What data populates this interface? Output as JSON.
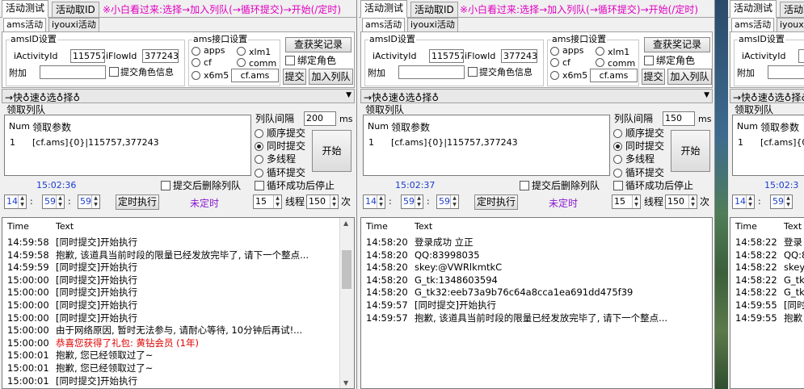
{
  "tabs": {
    "test": "活动测试",
    "fetch": "活动取ID"
  },
  "notice": "※小白看过来:选择→加入列队(→循环提交)→开始(/定时)",
  "subtabs": {
    "ams": "ams活动",
    "iyouxi": "iyouxi活动"
  },
  "amsid_group": {
    "title": "amsID设置",
    "iactivityid_label": "iActivityId",
    "iactivityid_value": "115757",
    "iflowid_label": "iFlowId",
    "iflowid_value": "377243",
    "extra_label": "附加",
    "extra_value": "",
    "submit_role_info": "提交角色信息"
  },
  "api_group": {
    "title": "ams接口设置",
    "options": [
      "apps",
      "xlm1",
      "cf",
      "comm",
      "x6m5"
    ],
    "selected": "",
    "api_value": "cf.ams",
    "submit_button": "提交"
  },
  "buttons": {
    "query_records": "查获奖记录",
    "bind_role": "绑定角色",
    "add_queue": "加入列队",
    "start": "开始",
    "timed_run": "定时执行"
  },
  "quickbar": "→快♁速♁选♁择♁",
  "queue": {
    "title": "领取列队",
    "col_num": "Num",
    "col_param": "领取参数",
    "row_num": "1",
    "row_param": "[cf.ams]{0}|115757,377243"
  },
  "queue_interval": {
    "label": "列队间隔",
    "unit": "ms"
  },
  "submit_modes": [
    "顺序提交",
    "同时提交",
    "多线程",
    "循环提交"
  ],
  "selected_mode": "同时提交",
  "options": {
    "delete_after_submit": "提交后删除列队",
    "stop_after_loop": "循环成功后停止",
    "untimed": "未定时",
    "thread_label": "线程",
    "times_label": "次"
  },
  "log_headers": {
    "time": "Time",
    "text": "Text"
  },
  "windows": [
    {
      "interval_value": "200",
      "clock": "15:02:36",
      "timer": {
        "h": "14",
        "m": "59",
        "s": "59"
      },
      "loop_count": "15",
      "thread_count": "150",
      "log": [
        {
          "time": "14:59:58",
          "text": "[同时提交]开始执行",
          "color": "#000000"
        },
        {
          "time": "14:59:58",
          "text": "抱歉, 该道具当前时段的限量已经发放完毕了, 请下一个整点...",
          "color": "#000000"
        },
        {
          "time": "14:59:59",
          "text": "[同时提交]开始执行",
          "color": "#000000"
        },
        {
          "time": "15:00:00",
          "text": "[同时提交]开始执行",
          "color": "#000000"
        },
        {
          "time": "15:00:00",
          "text": "[同时提交]开始执行",
          "color": "#000000"
        },
        {
          "time": "15:00:00",
          "text": "[同时提交]开始执行",
          "color": "#000000"
        },
        {
          "time": "15:00:00",
          "text": "[同时提交]开始执行",
          "color": "#000000"
        },
        {
          "time": "15:00:00",
          "text": "由于网络原因, 暂时无法参与, 请耐心等待, 10分钟后再试!...",
          "color": "#000000"
        },
        {
          "time": "15:00:00",
          "text": "恭喜您获得了礼包: 黄钻会员 (1年)",
          "color": "#e00000"
        },
        {
          "time": "15:00:01",
          "text": "抱歉, 您已经领取过了~",
          "color": "#000000"
        },
        {
          "time": "15:00:01",
          "text": "抱歉, 您已经领取过了~",
          "color": "#000000"
        },
        {
          "time": "15:00:01",
          "text": "[同时提交]开始执行",
          "color": "#000000"
        }
      ]
    },
    {
      "interval_value": "150",
      "clock": "15:02:37",
      "timer": {
        "h": "14",
        "m": "59",
        "s": "59"
      },
      "loop_count": "15",
      "thread_count": "150",
      "log": [
        {
          "time": "14:58:20",
          "text": "登录成功 立正",
          "color": "#000000"
        },
        {
          "time": "14:58:20",
          "text": "QQ:83998035",
          "color": "#000000"
        },
        {
          "time": "14:58:20",
          "text": "skey:@VWRlkmtkC",
          "color": "#000000"
        },
        {
          "time": "14:58:20",
          "text": "G_tk:1348603594",
          "color": "#000000"
        },
        {
          "time": "14:58:20",
          "text": "G_tk32:eeb73a9b76c64a8cca1ea691dd475f39",
          "color": "#000000"
        },
        {
          "time": "14:59:57",
          "text": "[同时提交]开始执行",
          "color": "#000000"
        },
        {
          "time": "14:59:57",
          "text": "抱歉, 该道具当前时段的限量已经发放完毕了, 请下一个整点...",
          "color": "#000000"
        }
      ]
    },
    {
      "interval_value": "",
      "clock": "15:02:3",
      "timer": {
        "h": "14",
        "m": "59",
        "s": ""
      },
      "loop_count": "",
      "thread_count": "",
      "log": [
        {
          "time": "14:58:22",
          "text": "登录",
          "color": "#000000"
        },
        {
          "time": "14:58:22",
          "text": "QQ:8",
          "color": "#000000"
        },
        {
          "time": "14:58:22",
          "text": "skey",
          "color": "#000000"
        },
        {
          "time": "14:58:22",
          "text": "G_tk",
          "color": "#000000"
        },
        {
          "time": "14:58:22",
          "text": "G_tk",
          "color": "#000000"
        },
        {
          "time": "14:59:55",
          "text": "[同时",
          "color": "#000000"
        },
        {
          "time": "14:59:55",
          "text": "抱歉",
          "color": "#000000"
        }
      ]
    }
  ]
}
